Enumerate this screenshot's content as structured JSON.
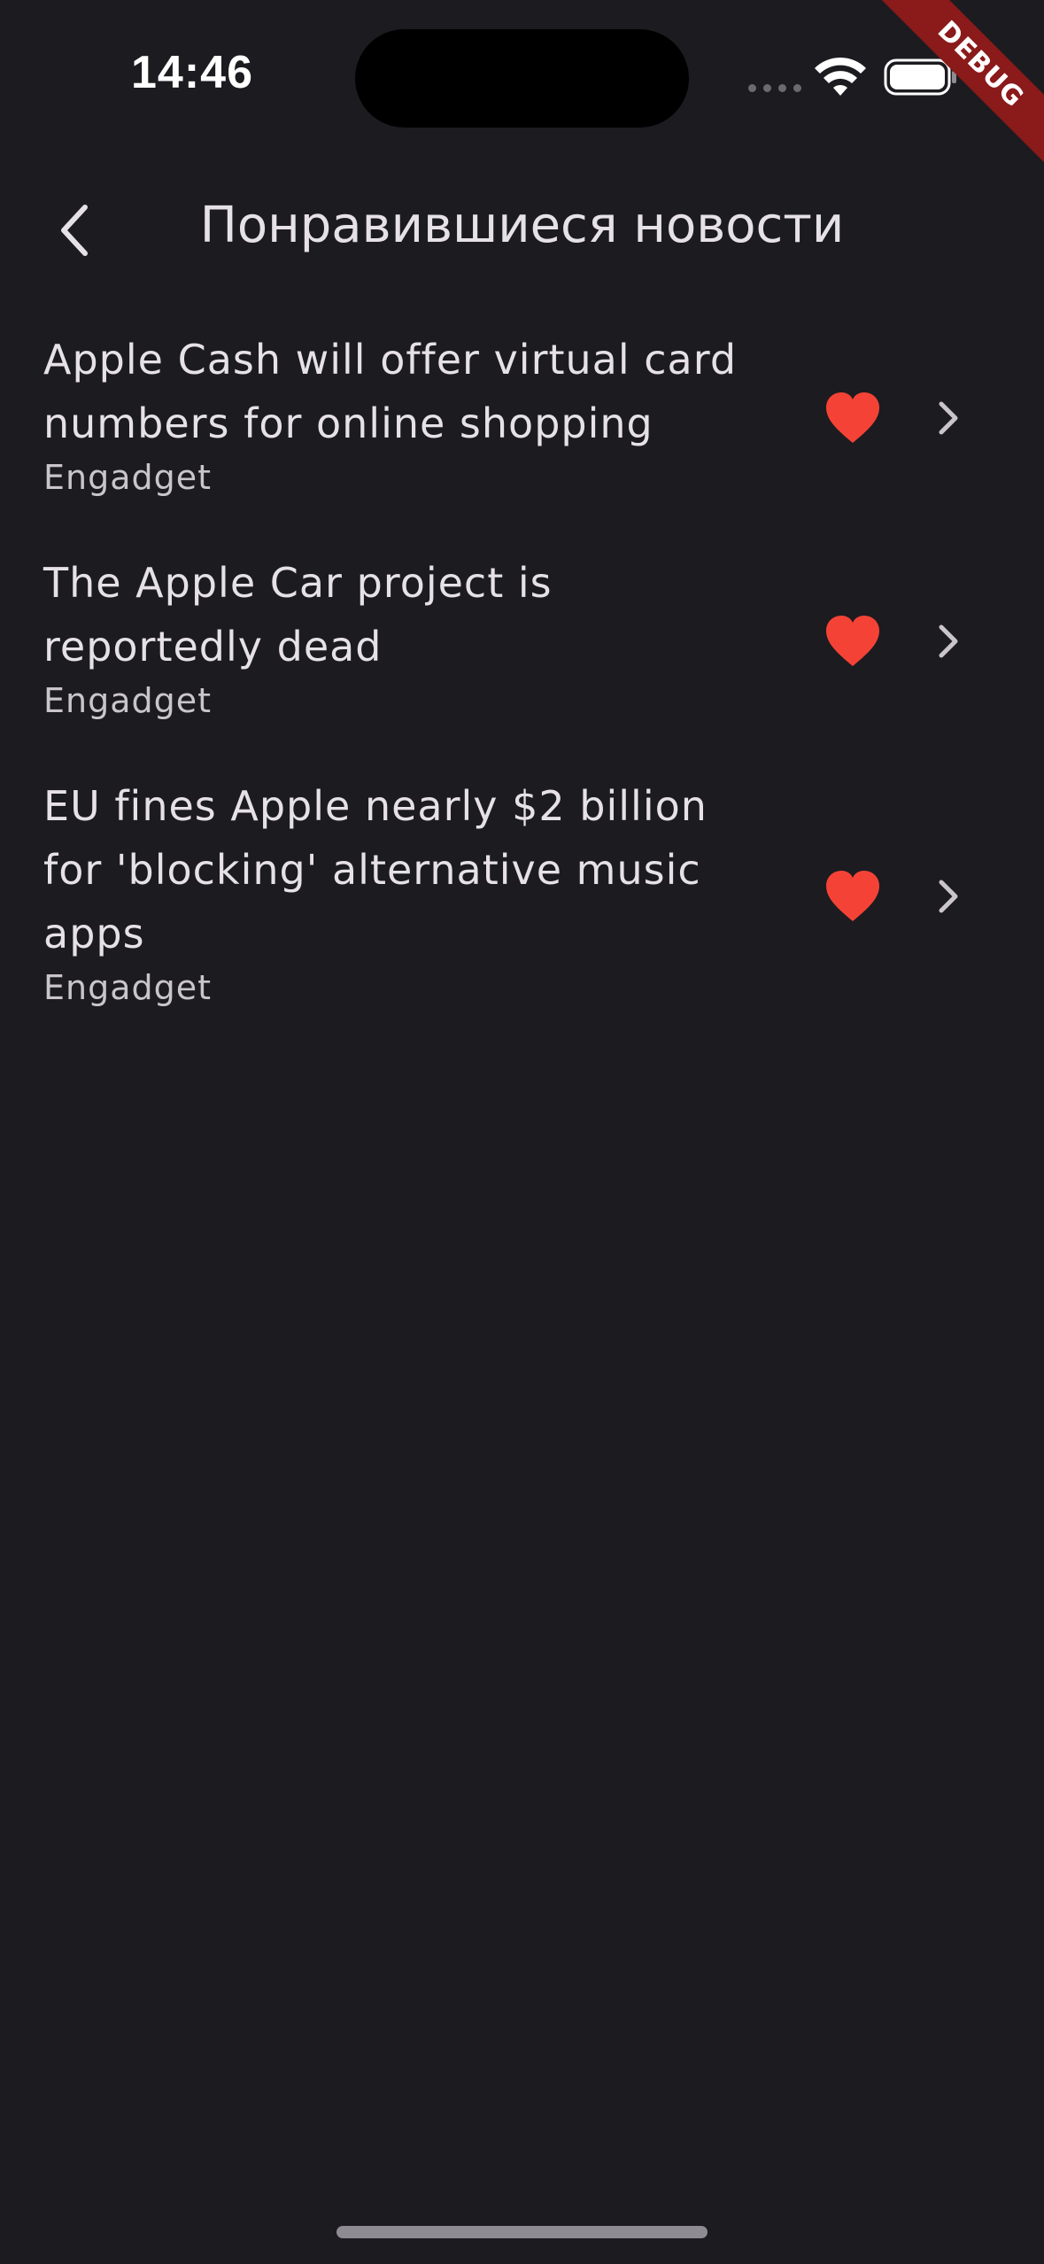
{
  "status_bar": {
    "time": "14:46"
  },
  "debug_banner": {
    "label": "DEBUG",
    "color": "#8b1a1a"
  },
  "app_bar": {
    "back_icon": "chevron-left-icon",
    "title": "Понравившиеся новости"
  },
  "news": [
    {
      "title": "Apple Cash will offer virtual card numbers for online shopping",
      "title_lines": [
        "Apple Cash will offer virtual card",
        "numbers for online shopping"
      ],
      "source": "Engadget",
      "liked": true
    },
    {
      "title": "The Apple Car project is reportedly dead",
      "title_lines": [
        "The Apple Car project is",
        "reportedly dead"
      ],
      "source": "Engadget",
      "liked": true
    },
    {
      "title": "EU fines Apple nearly $2 billion for 'blocking' alternative music apps",
      "title_lines": [
        "EU fines Apple nearly $2 billion",
        "for 'blocking' alternative music",
        "apps"
      ],
      "source": "Engadget",
      "liked": true
    }
  ],
  "colors": {
    "background": "#1c1b20",
    "heart": "#f44336",
    "text_primary": "#e6e1e5",
    "text_secondary": "#c9c5ca"
  }
}
